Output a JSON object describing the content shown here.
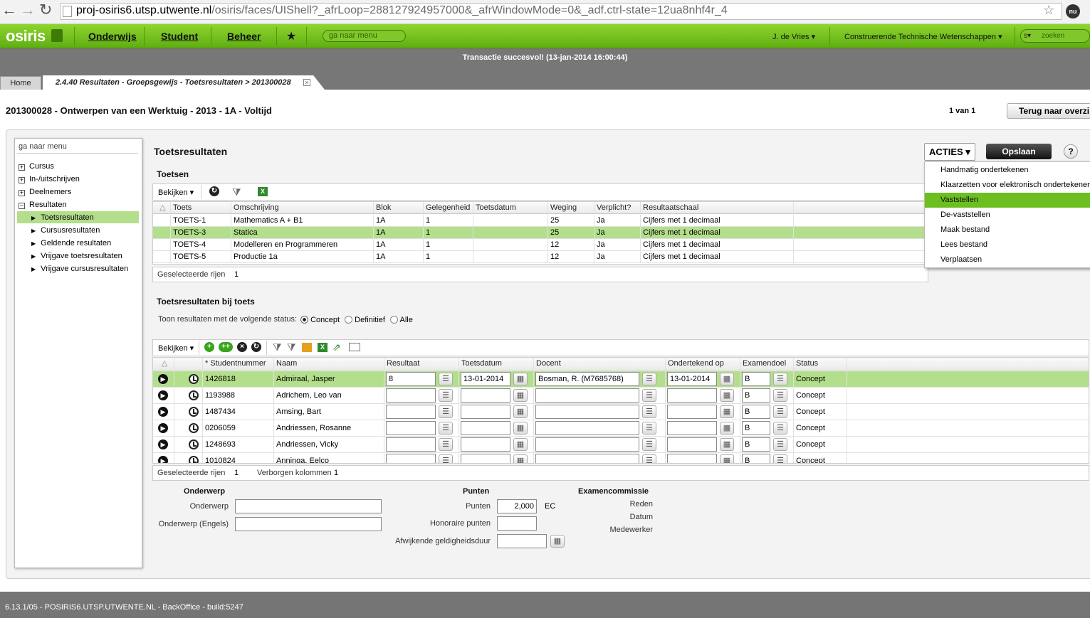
{
  "browser": {
    "url_host": "proj-osiris6.utsp.utwente.nl",
    "url_rest": "/osiris/faces/UIShell?_afrLoop=288127924957000&_afrWindowMode=0&_adf.ctrl-state=12ua8nhf4r_4"
  },
  "app": {
    "logo": "osiris",
    "menu": [
      "Onderwijs",
      "Student",
      "Beheer"
    ],
    "star": "★",
    "goto_placeholder": "ga naar menu",
    "user": "J. de Vries",
    "faculty": "Construerende Technische Wetenschappen",
    "search_scope": "s",
    "search_placeholder": "zoeken",
    "accent": "#6cbf1f"
  },
  "status_message": "Transactie succesvol! (13-jan-2014 16:00:44)",
  "tabs": {
    "home": "Home",
    "current": "2.4.40 Resultaten - Groepsgewijs - Toetsresultaten > 201300028"
  },
  "header": {
    "title": "201300028 - Ontwerpen van een Werktuig - 2013 - 1A - Voltijd",
    "count": "1 van 1",
    "back_button": "Terug naar overzi"
  },
  "sidebar": {
    "search_placeholder": "ga naar menu",
    "items": [
      {
        "label": "Cursus",
        "sign": "+"
      },
      {
        "label": "In-/uitschrijven",
        "sign": "+"
      },
      {
        "label": "Deelnemers",
        "sign": "+"
      },
      {
        "label": "Resultaten",
        "sign": "−"
      }
    ],
    "subitems": [
      "Toetsresultaten",
      "Cursusresultaten",
      "Geldende resultaten",
      "Vrijgave toetsresultaten",
      "Vrijgave cursusresultaten"
    ]
  },
  "content": {
    "title": "Toetsresultaten",
    "acties": "ACTIES",
    "opslaan": "Opslaan",
    "help": "?",
    "menu": [
      "Handmatig ondertekenen",
      "Klaarzetten voor elektronisch ondertekenen",
      "Vaststellen",
      "De-vaststellen",
      "Maak bestand",
      "Lees bestand",
      "Verplaatsen"
    ],
    "toetsen": {
      "title": "Toetsen",
      "bekijken": "Bekijken",
      "headers": [
        "Toets",
        "Omschrijving",
        "Blok",
        "Gelegenheid",
        "Toetsdatum",
        "Weging",
        "Verplicht?",
        "Resultaatschaal"
      ],
      "rows": [
        [
          "TOETS-1",
          "Mathematics A + B1",
          "1A",
          "1",
          "",
          "25",
          "Ja",
          "Cijfers met 1 decimaal"
        ],
        [
          "TOETS-3",
          "Statica",
          "1A",
          "1",
          "",
          "25",
          "Ja",
          "Cijfers met 1 decimaal"
        ],
        [
          "TOETS-4",
          "Modelleren en Programmeren",
          "1A",
          "1",
          "",
          "12",
          "Ja",
          "Cijfers met 1 decimaal"
        ],
        [
          "TOETS-5",
          "Productie 1a",
          "1A",
          "1",
          "",
          "12",
          "Ja",
          "Cijfers met 1 decimaal"
        ]
      ],
      "selected_label": "Geselecteerde rijen",
      "selected_count": "1"
    },
    "resultaten": {
      "title": "Toetsresultaten bij toets",
      "status_label": "Toon resultaten met de volgende status:",
      "status_options": [
        "Concept",
        "Definitief",
        "Alle"
      ],
      "bekijken": "Bekijken",
      "headers": [
        "* Studentnummer",
        "Naam",
        "Resultaat",
        "Toetsdatum",
        "Docent",
        "Ondertekend op",
        "Examendoel",
        "Status"
      ],
      "rows": [
        {
          "nr": "1426818",
          "naam": "Admiraal, Jasper",
          "resultaat": "8",
          "datum": "13-01-2014",
          "docent": "Bosman, R. (M7685768)",
          "ondertekend": "13-01-2014",
          "doel": "B",
          "status": "Concept"
        },
        {
          "nr": "1193988",
          "naam": "Adrichem, Leo van",
          "resultaat": "",
          "datum": "",
          "docent": "",
          "ondertekend": "",
          "doel": "B",
          "status": "Concept"
        },
        {
          "nr": "1487434",
          "naam": "Amsing, Bart",
          "resultaat": "",
          "datum": "",
          "docent": "",
          "ondertekend": "",
          "doel": "B",
          "status": "Concept"
        },
        {
          "nr": "0206059",
          "naam": "Andriessen, Rosanne",
          "resultaat": "",
          "datum": "",
          "docent": "",
          "ondertekend": "",
          "doel": "B",
          "status": "Concept"
        },
        {
          "nr": "1248693",
          "naam": "Andriessen, Vicky",
          "resultaat": "",
          "datum": "",
          "docent": "",
          "ondertekend": "",
          "doel": "B",
          "status": "Concept"
        },
        {
          "nr": "1010824",
          "naam": "Anninga, Eelco",
          "resultaat": "",
          "datum": "",
          "docent": "",
          "ondertekend": "",
          "doel": "B",
          "status": "Concept"
        }
      ],
      "selected_label": "Geselecteerde rijen",
      "selected_count": "1",
      "hidden_label": "Verborgen kolommen",
      "hidden_count": "1"
    },
    "details": {
      "onderwerp_title": "Onderwerp",
      "onderwerp_label": "Onderwerp",
      "onderwerp_en_label": "Onderwerp (Engels)",
      "punten_title": "Punten",
      "punten_label": "Punten",
      "punten_value": "2,000",
      "punten_unit": "EC",
      "honoraire_label": "Honoraire punten",
      "afwijkend_label": "Afwijkende geldigheidsduur",
      "commissie_title": "Examencommissie",
      "reden_label": "Reden",
      "datum_label": "Datum",
      "medewerker_label": "Medewerker"
    }
  },
  "footer": "6.13.1/05 - POSIRIS6.UTSP.UTWENTE.NL - BackOffice - build:5247"
}
